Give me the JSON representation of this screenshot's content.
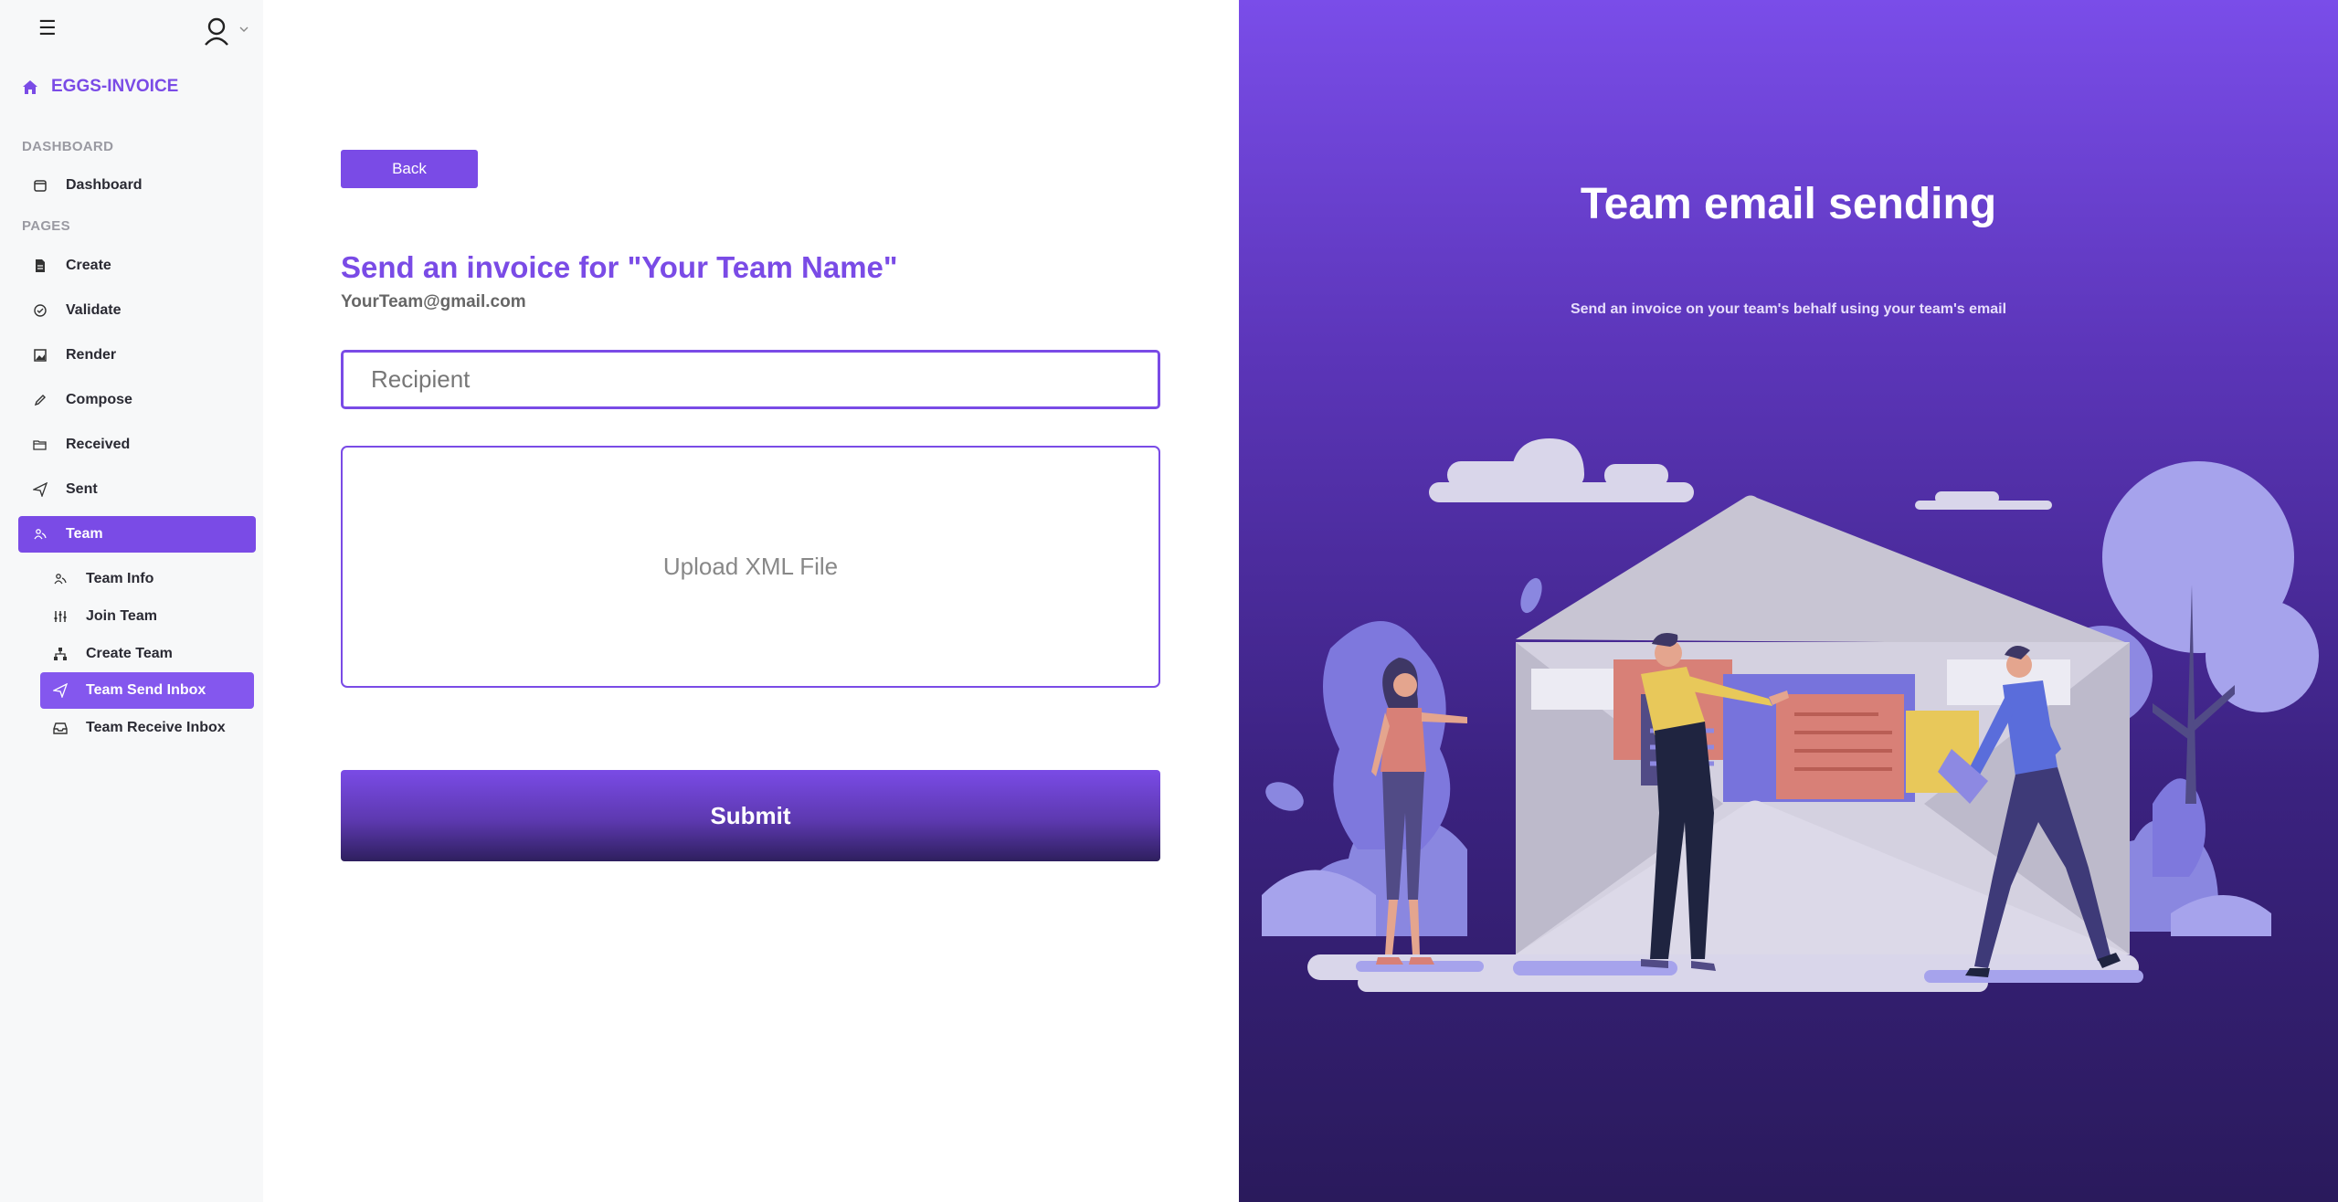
{
  "sidebar": {
    "brand": "EGGS-INVOICE",
    "sections": {
      "dashboard_label": "DASHBOARD",
      "pages_label": "PAGES"
    },
    "items": [
      {
        "label": "Dashboard",
        "icon": "calendar-icon"
      },
      {
        "label": "Create",
        "icon": "file-icon"
      },
      {
        "label": "Validate",
        "icon": "check-circle-icon"
      },
      {
        "label": "Render",
        "icon": "image-icon"
      },
      {
        "label": "Compose",
        "icon": "pencil-icon"
      },
      {
        "label": "Received",
        "icon": "folder-open-icon"
      },
      {
        "label": "Sent",
        "icon": "send-icon"
      },
      {
        "label": "Team",
        "icon": "team-icon"
      }
    ],
    "team_sub_items": [
      {
        "label": "Team Info",
        "icon": "team-icon"
      },
      {
        "label": "Join Team",
        "icon": "sliders-icon"
      },
      {
        "label": "Create Team",
        "icon": "sitemap-icon"
      },
      {
        "label": "Team Send Inbox",
        "icon": "send-icon"
      },
      {
        "label": "Team Receive Inbox",
        "icon": "inbox-icon"
      }
    ],
    "active_item": "Team",
    "active_sub_item": "Team Send Inbox"
  },
  "form": {
    "back_label": "Back",
    "title": "Send an invoice for \"Your Team Name\"",
    "email": "YourTeam@gmail.com",
    "recipient_placeholder": "Recipient",
    "upload_label": "Upload XML File",
    "submit_label": "Submit"
  },
  "panel": {
    "title": "Team email sending",
    "subtitle": "Send an invoice on your team's behalf using your team's email"
  },
  "colors": {
    "accent": "#7a4be6",
    "panel_top": "#7a4de9",
    "panel_bottom": "#2a1a5c"
  }
}
